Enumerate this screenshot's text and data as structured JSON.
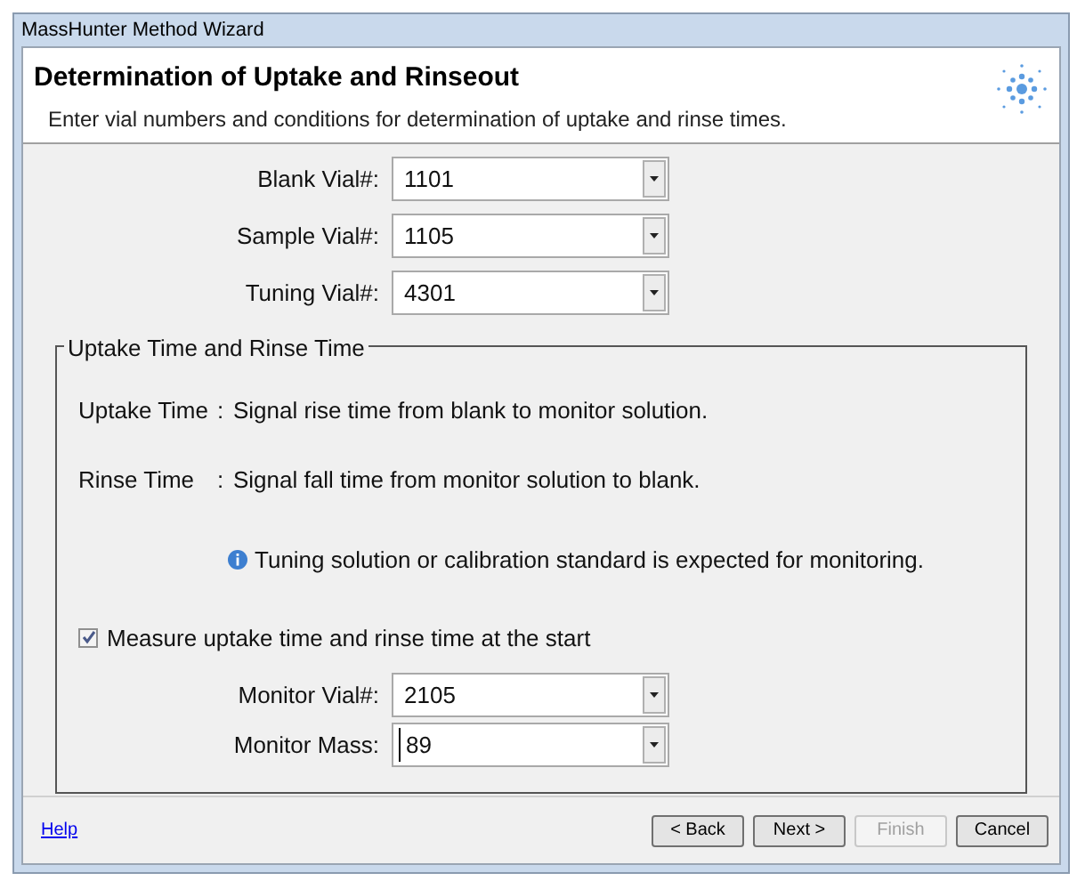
{
  "window": {
    "title": "MassHunter Method Wizard"
  },
  "header": {
    "title": "Determination of Uptake and Rinseout",
    "subtitle": "Enter vial numbers and conditions for determination of uptake and rinse times."
  },
  "fields": [
    {
      "label": "Blank Vial#:",
      "value": "1101",
      "focused": false
    },
    {
      "label": "Sample Vial#:",
      "value": "1105",
      "focused": false
    },
    {
      "label": "Tuning Vial#:",
      "value": "4301",
      "focused": false
    }
  ],
  "group": {
    "title": "Uptake Time and Rinse Time",
    "definitions": [
      {
        "term": "Uptake Time",
        "separator": ":",
        "text": "Signal rise time from blank to monitor solution."
      },
      {
        "term": "Rinse Time",
        "separator": ":",
        "text": "Signal fall time from monitor solution to blank."
      }
    ],
    "note": "Tuning solution or calibration standard is expected for monitoring.",
    "checkbox": {
      "label": "Measure uptake time and rinse time at the start",
      "checked": true
    },
    "monitor_fields": [
      {
        "label": "Monitor Vial#:",
        "value": "2105",
        "focused": false
      },
      {
        "label": "Monitor Mass:",
        "value": "89",
        "focused": true
      }
    ]
  },
  "footer": {
    "help": "Help",
    "buttons": [
      {
        "label": "< Back",
        "disabled": false
      },
      {
        "label": "Next >",
        "disabled": false
      },
      {
        "label": "Finish",
        "disabled": true
      },
      {
        "label": "Cancel",
        "disabled": false
      }
    ]
  }
}
